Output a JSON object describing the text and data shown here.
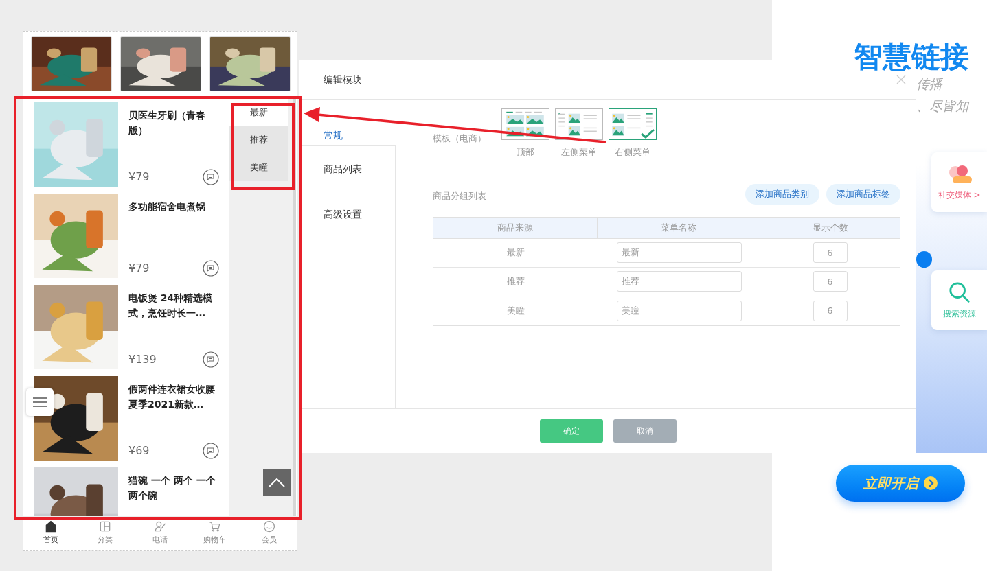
{
  "preview": {
    "products": [
      {
        "name": "贝医生牙刷（青春版）",
        "price": "¥79"
      },
      {
        "name": "多功能宿舍电煮锅",
        "price": "¥79"
      },
      {
        "name": "电饭煲 24种精选模式，烹饪时长一…",
        "price": "¥139"
      },
      {
        "name": "假两件连衣裙女收腰夏季2021新款…",
        "price": "¥69"
      },
      {
        "name": "猫碗 一个 两个 一个两个碗"
      }
    ],
    "menu": [
      {
        "label": "最新",
        "selected": true
      },
      {
        "label": "推荐",
        "selected": false
      },
      {
        "label": "美瞳",
        "selected": false
      }
    ],
    "tabbar": [
      {
        "label": "首页",
        "kind": "home",
        "selected": true
      },
      {
        "label": "分类",
        "kind": "category",
        "selected": false
      },
      {
        "label": "电话",
        "kind": "phone",
        "selected": false
      },
      {
        "label": "购物车",
        "kind": "cart",
        "selected": false
      },
      {
        "label": "会员",
        "kind": "member",
        "selected": false
      }
    ]
  },
  "dialog": {
    "title": "编辑模块",
    "nav": [
      {
        "label": "常规",
        "selected": true
      },
      {
        "label": "商品列表",
        "selected": false
      },
      {
        "label": "高级设置",
        "selected": false
      }
    ],
    "template_label": "模板（电商）",
    "templates": [
      {
        "label": "顶部",
        "kind": "top",
        "selected": false
      },
      {
        "label": "左侧菜单",
        "kind": "left",
        "selected": false
      },
      {
        "label": "右侧菜单",
        "kind": "right",
        "selected": true
      }
    ],
    "group_label": "商品分组列表",
    "actions": [
      "添加商品类别",
      "添加商品标签"
    ],
    "table": {
      "columns": [
        "商品来源",
        "菜单名称",
        "显示个数"
      ],
      "rows": [
        {
          "source": "最新",
          "name": "最新",
          "count": "6"
        },
        {
          "source": "推荐",
          "name": "推荐",
          "count": "6"
        },
        {
          "source": "美瞳",
          "name": "美瞳",
          "count": "6"
        }
      ]
    },
    "buttons": [
      {
        "label": "确定",
        "kind": "primary"
      },
      {
        "label": "取消",
        "kind": "secondary"
      }
    ]
  },
  "promo": {
    "title": "智慧链接",
    "lines": [
      "传播",
      "、尽皆知"
    ],
    "cards": [
      {
        "label": "社交媒体 >",
        "kind": "social"
      },
      {
        "label": "搜索资源",
        "kind": "search"
      }
    ],
    "cta": "立即开启"
  }
}
